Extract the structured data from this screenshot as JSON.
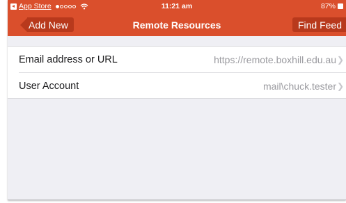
{
  "status_bar": {
    "back_app": "App Store",
    "time": "11:21 am",
    "battery": "87%"
  },
  "nav": {
    "back_label": "Add New",
    "title": "Remote Resources",
    "right_label": "Find Feed"
  },
  "rows": [
    {
      "label": "Email address or URL",
      "value": "https://remote.boxhill.edu.au"
    },
    {
      "label": "User Account",
      "value": "mail\\chuck.tester"
    }
  ],
  "colors": {
    "header": "#da4f2c",
    "button": "#b8391c",
    "background": "#efeff4"
  }
}
